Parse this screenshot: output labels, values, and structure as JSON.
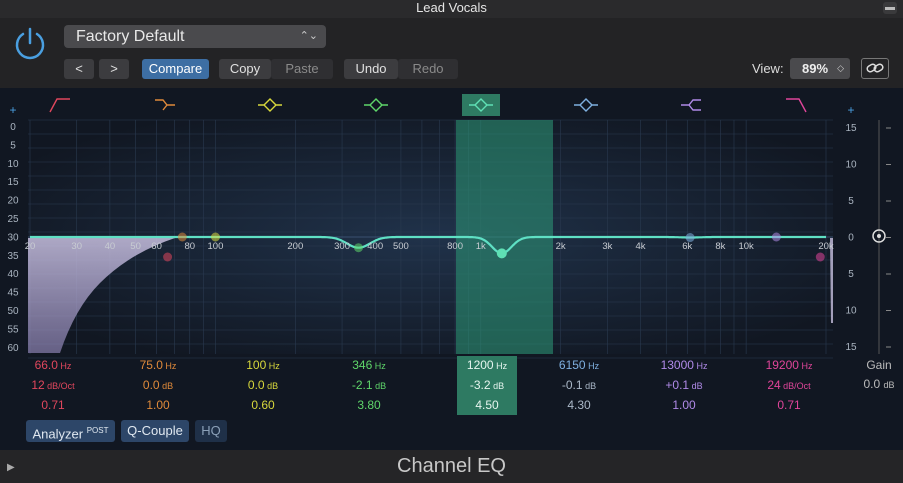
{
  "window": {
    "title": "Lead Vocals"
  },
  "toolbar": {
    "preset": "Factory Default",
    "prev": "<",
    "next": ">",
    "compare": "Compare",
    "copy": "Copy",
    "paste": "Paste",
    "undo": "Undo",
    "redo": "Redo",
    "view_label": "View:",
    "view_value": "89%"
  },
  "plus_left": "+",
  "plus_right": "+",
  "left_scale": [
    "0",
    "5",
    "10",
    "15",
    "20",
    "25",
    "30",
    "35",
    "40",
    "45",
    "50",
    "55",
    "60"
  ],
  "right_scale": [
    "15",
    "10",
    "5",
    "0",
    "5",
    "10",
    "15"
  ],
  "freq_labels": [
    "20",
    "30",
    "40",
    "50",
    "60",
    "80",
    "100",
    "200",
    "300",
    "400",
    "500",
    "800",
    "1k",
    "2k",
    "3k",
    "4k",
    "6k",
    "8k",
    "10k",
    "20k"
  ],
  "bands": [
    {
      "freq": "66.0",
      "freq_unit": "Hz",
      "gain": "12",
      "gain_unit": "dB/Oct",
      "q": "0.71",
      "color": "#e0475d",
      "shape": "lowcut"
    },
    {
      "freq": "75.0",
      "freq_unit": "Hz",
      "gain": "0.0",
      "gain_unit": "dB",
      "q": "1.00",
      "color": "#e08a3a",
      "shape": "lowshelf"
    },
    {
      "freq": "100",
      "freq_unit": "Hz",
      "gain": "0.0",
      "gain_unit": "dB",
      "q": "0.60",
      "color": "#d8d83c",
      "shape": "bell"
    },
    {
      "freq": "346",
      "freq_unit": "Hz",
      "gain": "-2.1",
      "gain_unit": "dB",
      "q": "3.80",
      "color": "#5fd66a",
      "shape": "bell"
    },
    {
      "freq": "1200",
      "freq_unit": "Hz",
      "gain": "-3.2",
      "gain_unit": "dB",
      "q": "4.50",
      "color": "#5fe0b4",
      "shape": "bell",
      "selected": true
    },
    {
      "freq": "6150",
      "freq_unit": "Hz",
      "gain": "-0.1",
      "gain_unit": "dB",
      "q": "4.30",
      "color": "#7fb0e0",
      "shape": "bell"
    },
    {
      "freq": "13000",
      "freq_unit": "Hz",
      "gain": "+0.1",
      "gain_unit": "dB",
      "q": "1.00",
      "color": "#b08ae8",
      "shape": "highshelf"
    },
    {
      "freq": "19200",
      "freq_unit": "Hz",
      "gain": "24",
      "gain_unit": "dB/Oct",
      "q": "0.71",
      "color": "#e0459a",
      "shape": "highcut"
    }
  ],
  "gain": {
    "label": "Gain",
    "value": "0.0",
    "unit": "dB"
  },
  "bottom": {
    "analyzer": "Analyzer",
    "analyzer_sup": "POST",
    "qcouple": "Q-Couple",
    "hq": "HQ"
  },
  "footer": {
    "plugin_name": "Channel EQ"
  }
}
